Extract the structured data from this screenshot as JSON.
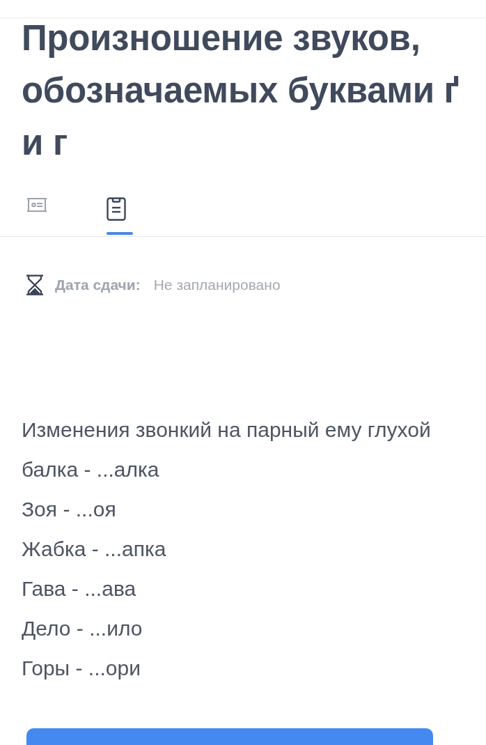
{
  "title": "Произношение звуков, обозначаемых буквами ґ и г",
  "tabs": [
    {
      "kind": "board",
      "selected": false
    },
    {
      "kind": "clipboard",
      "selected": true
    }
  ],
  "due_date": {
    "label": "Дата сдачи:",
    "value": "Не запланировано"
  },
  "lines": [
    "Изменения звонкий на парный ему глухой",
    "балка - ...алка",
    "Зоя - ...оя",
    "Жабка - ...апка",
    "Гава - ...ава",
    "Дело - ...ило",
    "Горы - ...ори"
  ],
  "buttons": [
    {
      "kind": "primary"
    }
  ]
}
